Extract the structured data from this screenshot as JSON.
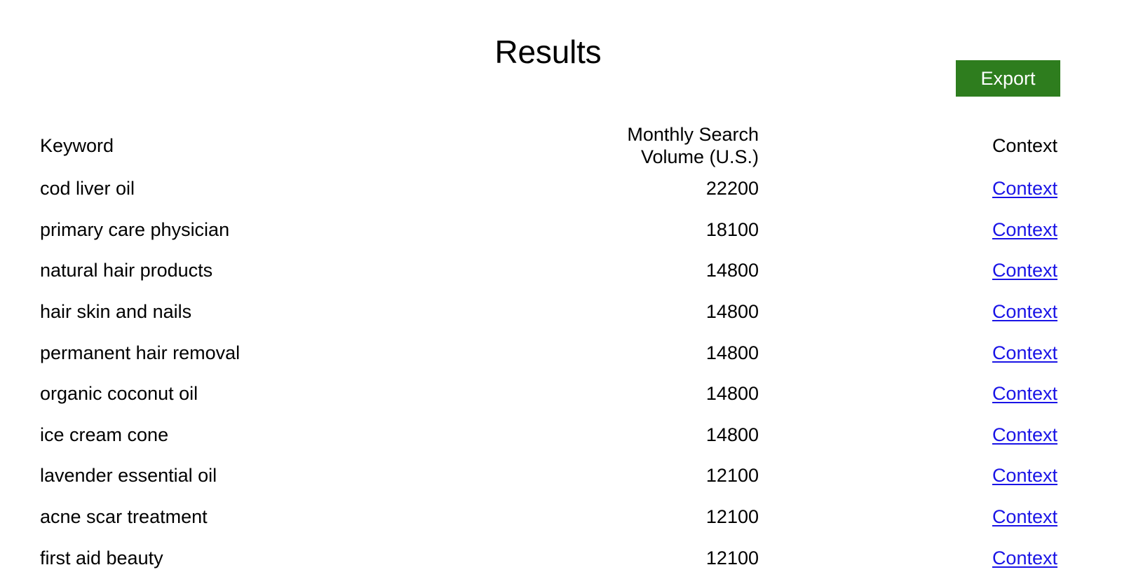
{
  "header": {
    "title": "Results"
  },
  "toolbar": {
    "export_label": "Export",
    "export_color": "#2E7D1E",
    "export_text_color": "#FFFFFF"
  },
  "table": {
    "columns": [
      {
        "key": "keyword",
        "label": "Keyword",
        "align": "left"
      },
      {
        "key": "volume",
        "label": "Monthly Search Volume (U.S.)",
        "align": "right"
      },
      {
        "key": "context",
        "label": "Context",
        "align": "right"
      }
    ],
    "link_color": "#1A14E6",
    "rows": [
      {
        "keyword": "cod liver oil",
        "volume": "22200",
        "context": "Context"
      },
      {
        "keyword": "primary care physician",
        "volume": "18100",
        "context": "Context"
      },
      {
        "keyword": "natural hair products",
        "volume": "14800",
        "context": "Context"
      },
      {
        "keyword": "hair skin and nails",
        "volume": "14800",
        "context": "Context"
      },
      {
        "keyword": "permanent hair removal",
        "volume": "14800",
        "context": "Context"
      },
      {
        "keyword": "organic coconut oil",
        "volume": "14800",
        "context": "Context"
      },
      {
        "keyword": "ice cream cone",
        "volume": "14800",
        "context": "Context"
      },
      {
        "keyword": "lavender essential oil",
        "volume": "12100",
        "context": "Context"
      },
      {
        "keyword": "acne scar treatment",
        "volume": "12100",
        "context": "Context"
      },
      {
        "keyword": "first aid beauty",
        "volume": "12100",
        "context": "Context"
      }
    ]
  }
}
